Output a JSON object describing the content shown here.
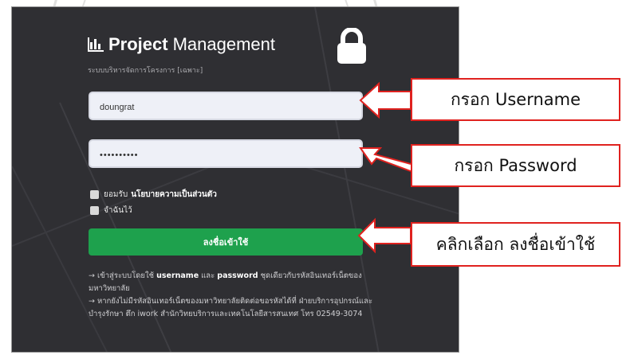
{
  "brand": {
    "title_bold": "Project",
    "title_rest": "Management",
    "subtitle": "ระบบบริหารจัดการโครงการ [เฉพาะ]"
  },
  "form": {
    "username_value": "doungrat",
    "password_value": "••••••••••",
    "consent_label": "ยอมรับ",
    "consent_link": "นโยบายความเป็นส่วนตัว",
    "remember_label": "จำฉันไว้",
    "login_button": "ลงชื่อเข้าใช้"
  },
  "notes": {
    "line1_pre": "→ เข้าสู่ระบบโดยใช้",
    "line1_user": "username",
    "line1_mid": "และ",
    "line1_pass": "password",
    "line1_post": "ชุดเดียวกับรหัสอินเทอร์เน็ตของมหาวิทยาลัย",
    "line2": "→ หากยังไม่มีรหัสอินเทอร์เน็ตของมหาวิทยาลัยติดต่อขอรหัสได้ที่ ฝ่ายบริการอุปกรณ์และบำรุงรักษา ตึก iwork สำนักวิทยบริการและเทคโนโลยีสารสนเทศ โทร 02549-3074"
  },
  "callouts": {
    "username": "กรอก Username",
    "password": "กรอก Password",
    "login": "คลิกเลือก ลงชื่อเข้าใช้"
  },
  "colors": {
    "panel_bg": "#2f2f33",
    "login_green": "#1ea14d",
    "callout_red": "#e0221f"
  },
  "icons": {
    "brand": "bar-chart-icon",
    "lock": "lock-icon"
  }
}
